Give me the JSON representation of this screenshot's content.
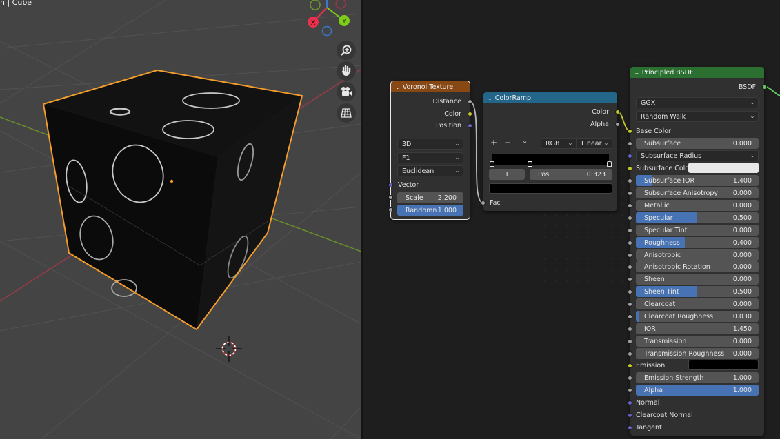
{
  "viewport": {
    "title": "n | Cube",
    "gizmo": {
      "x_label": "X",
      "y_label": "Y",
      "x_color": "#e8314d",
      "y_color": "#80cc1a",
      "z_color": "#3b78cc"
    },
    "nav_buttons": [
      {
        "name": "zoom-icon",
        "glyph": "⊕"
      },
      {
        "name": "hand-pan-icon",
        "glyph": "✋"
      },
      {
        "name": "camera-icon",
        "glyph": "🎥"
      },
      {
        "name": "grid-ortho-icon",
        "glyph": "▦"
      }
    ],
    "selection_color": "#f29c2c"
  },
  "nodes": {
    "voronoi": {
      "title": "Voronoi Texture",
      "header_color": "#874813",
      "outputs": [
        "Distance",
        "Color",
        "Position"
      ],
      "dropdowns": [
        "3D",
        "F1",
        "Euclidean"
      ],
      "input_vector": "Vector",
      "scale": {
        "label": "Scale",
        "value": "2.200",
        "fraction": 0
      },
      "randomness": {
        "label": "Randomn",
        "value": "1.000",
        "fraction": 1.0
      }
    },
    "colorramp": {
      "title": "ColorRamp",
      "header_color": "#24658a",
      "outputs": [
        "Color",
        "Alpha"
      ],
      "add_label": "+",
      "remove_label": "−",
      "menu_label": "⌄",
      "color_mode": "RGB",
      "interpolation": "Linear",
      "stop_positions": [
        0.0,
        0.323,
        1.0
      ],
      "active_index": "1",
      "pos_label": "Pos",
      "pos_value": "0.323",
      "stop_color": "#000000",
      "input_fac": "Fac"
    },
    "principled": {
      "title": "Principled BSDF",
      "header_color": "#2b7031",
      "output": "BSDF",
      "distribution": "GGX",
      "subsurface_method": "Random Walk",
      "base_color_label": "Base Color",
      "subsurface_radius_label": "Subsurface Radius",
      "subsurface_color_label": "Subsurface Color",
      "subsurface_color": "#e8e8e8",
      "emission_label": "Emission",
      "emission_color": "#000000",
      "sliders": [
        {
          "label": "Subsurface",
          "value": "0.000",
          "fraction": 0
        },
        {
          "label": "Subsurface IOR",
          "value": "1.400",
          "fraction": 0.13
        },
        {
          "label": "Subsurface Anisotropy",
          "value": "0.000",
          "fraction": 0
        },
        {
          "label": "Metallic",
          "value": "0.000",
          "fraction": 0
        },
        {
          "label": "Specular",
          "value": "0.500",
          "fraction": 0.5
        },
        {
          "label": "Specular Tint",
          "value": "0.000",
          "fraction": 0
        },
        {
          "label": "Roughness",
          "value": "0.400",
          "fraction": 0.4
        },
        {
          "label": "Anisotropic",
          "value": "0.000",
          "fraction": 0
        },
        {
          "label": "Anisotropic Rotation",
          "value": "0.000",
          "fraction": 0
        },
        {
          "label": "Sheen",
          "value": "0.000",
          "fraction": 0
        },
        {
          "label": "Sheen Tint",
          "value": "0.500",
          "fraction": 0.5
        },
        {
          "label": "Clearcoat",
          "value": "0.000",
          "fraction": 0
        },
        {
          "label": "Clearcoat Roughness",
          "value": "0.030",
          "fraction": 0.03
        },
        {
          "label": "IOR",
          "value": "1.450",
          "fraction": 0
        },
        {
          "label": "Transmission",
          "value": "0.000",
          "fraction": 0
        },
        {
          "label": "Transmission Roughness",
          "value": "0.000",
          "fraction": 0
        },
        {
          "label": "Emission Strength",
          "value": "1.000",
          "fraction": 0
        },
        {
          "label": "Alpha",
          "value": "1.000",
          "fraction": 1.0
        }
      ],
      "vector_inputs": [
        "Normal",
        "Clearcoat Normal",
        "Tangent"
      ]
    }
  }
}
